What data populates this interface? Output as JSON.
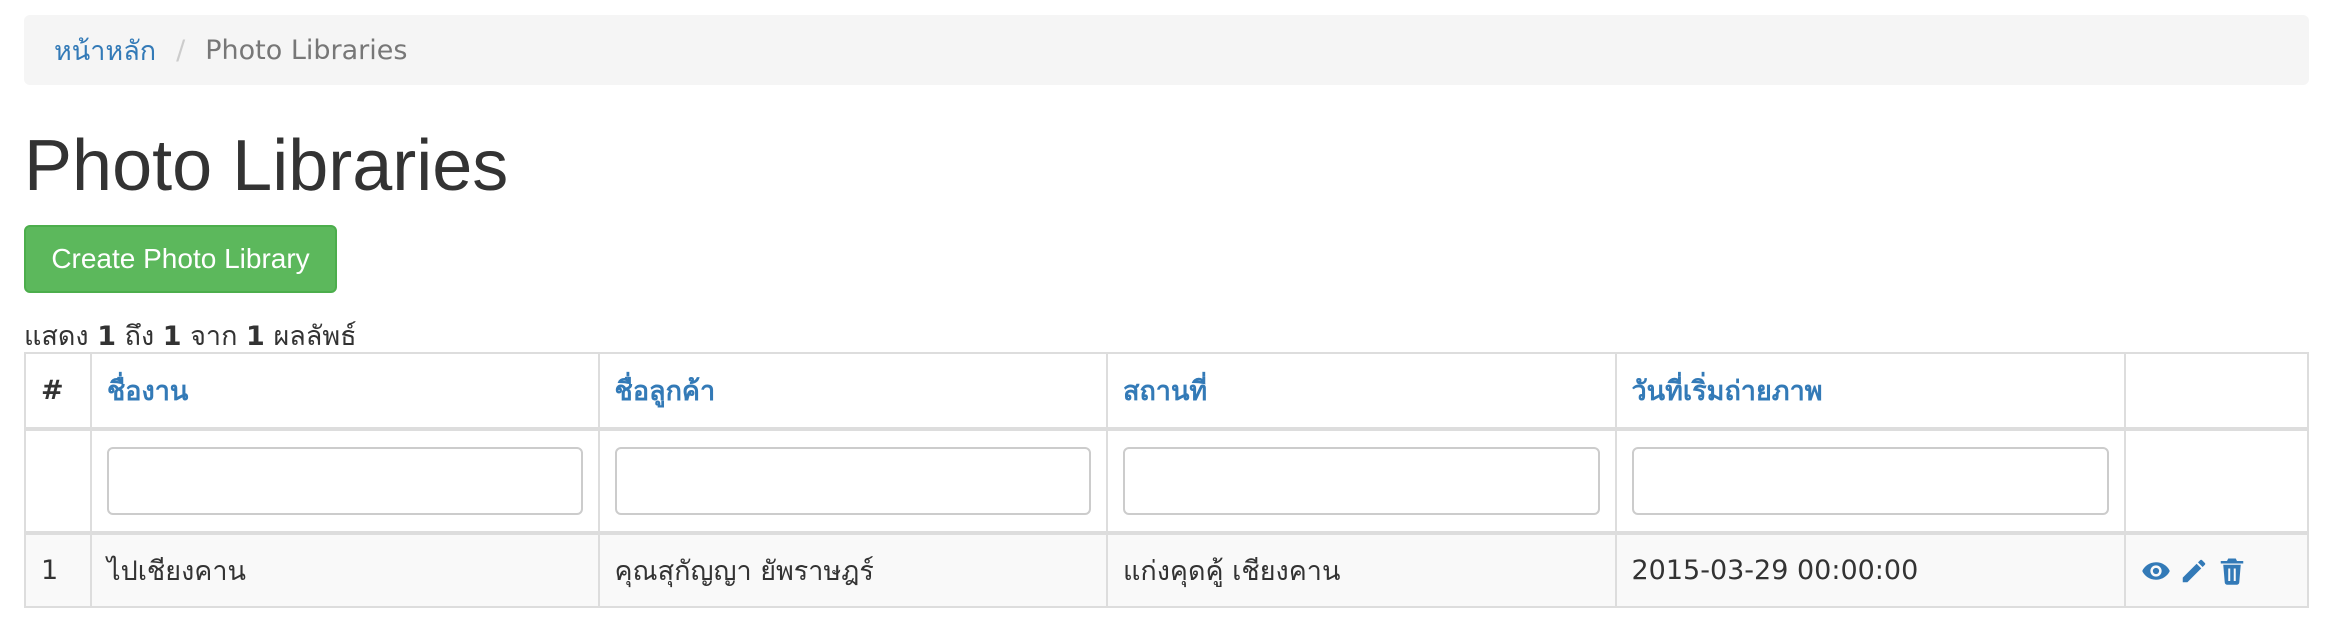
{
  "breadcrumb": {
    "home": "หน้าหลัก",
    "separator": "/",
    "current": "Photo Libraries"
  },
  "page_title": "Photo Libraries",
  "create_button": "Create Photo Library",
  "summary": {
    "prefix": "แสดง",
    "from": "1",
    "to_word": "ถึง",
    "to": "1",
    "of_word": "จาก",
    "total": "1",
    "suffix": "ผลลัพธ์"
  },
  "table": {
    "headers": {
      "num": "#",
      "job_name": "ชื่องาน",
      "customer_name": "ชื่อลูกค้า",
      "location": "สถานที่",
      "start_date": "วันที่เริ่มถ่ายภาพ"
    },
    "filters": {
      "job_name": "",
      "customer_name": "",
      "location": "",
      "start_date": ""
    },
    "rows": [
      {
        "num": "1",
        "job_name": "ไปเชียงคาน",
        "customer_name": "คุณสุกัญญา ยัพราษฎร์",
        "location": "แก่งคุดคู้ เชียงคาน",
        "start_date": "2015-03-29 00:00:00"
      }
    ],
    "action_icons": [
      "eye-icon",
      "pencil-icon",
      "trash-icon"
    ]
  },
  "colors": {
    "link": "#337ab7",
    "success": "#5cb85c",
    "breadcrumb_bg": "#f5f5f5",
    "border": "#dddddd"
  }
}
